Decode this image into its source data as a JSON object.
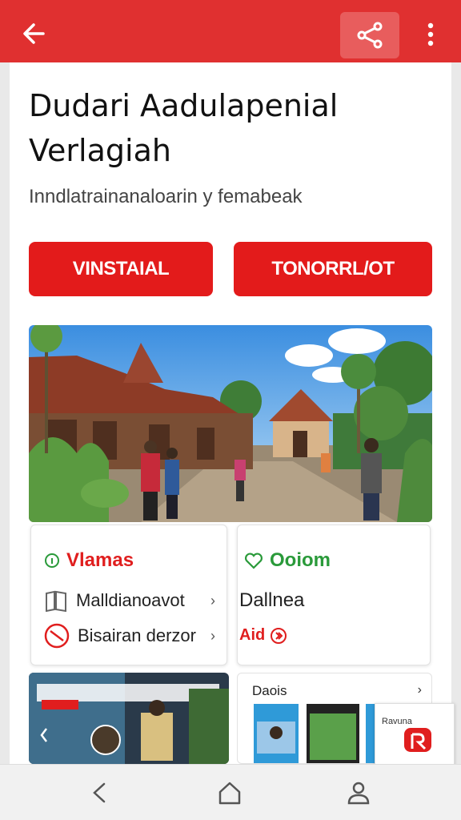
{
  "header": {
    "back_icon": "arrow-left-icon",
    "share_icon": "share-icon",
    "more_icon": "more-vertical-icon",
    "bar_color": "#e03030"
  },
  "article": {
    "title": "Dudari Aadulapenial Verlagiah",
    "subtitle": "Inndlatrainanaloarin y femabeak"
  },
  "buttons": {
    "primary_label": "VINSTAIAL",
    "secondary_label": "TONORRL/OT",
    "color": "#e31b1b"
  },
  "hero": {
    "icon": "photo-village-scene"
  },
  "panels": {
    "left": {
      "title": "Vlamas",
      "items": [
        {
          "label": "Malldianoavot",
          "icon": "book-icon"
        },
        {
          "label": "Bisairan derzor",
          "icon": "no-entry-icon"
        }
      ]
    },
    "right": {
      "title": "Ooiom",
      "text": "Dallnea",
      "link": "Aid"
    }
  },
  "thumbs": {
    "second_label": "Daois",
    "overlay_label": "Ravuna"
  },
  "navbar": {
    "back_icon": "nav-back-icon",
    "home_icon": "home-icon",
    "profile_icon": "profile-icon"
  }
}
